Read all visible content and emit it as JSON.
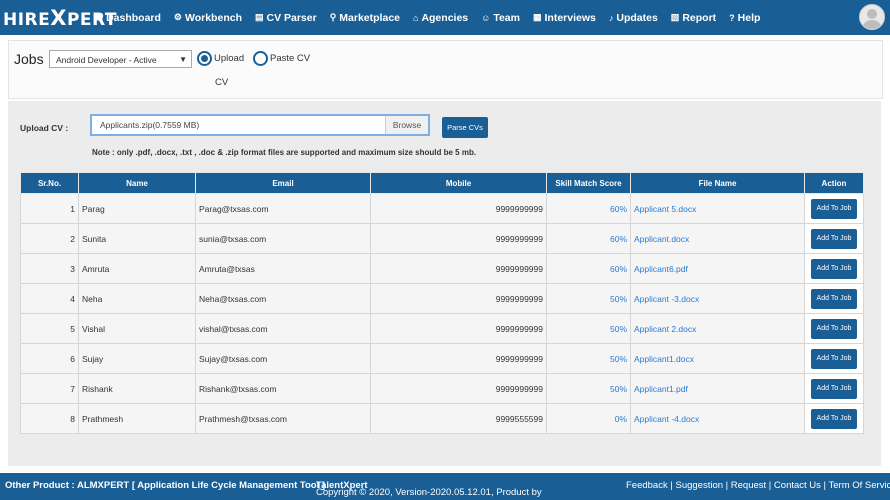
{
  "header": {
    "logo_left": "HIRE",
    "logo_x": "X",
    "logo_right": "PERT",
    "nav": [
      {
        "icon": "dashboard-icon",
        "glyph": "☗",
        "label": "Dashboard"
      },
      {
        "icon": "gears-icon",
        "glyph": "⚙",
        "label": "Workbench"
      },
      {
        "icon": "file-icon",
        "glyph": "▤",
        "label": "CV Parser"
      },
      {
        "icon": "map-marker-icon",
        "glyph": "⚲",
        "label": "Marketplace"
      },
      {
        "icon": "building-icon",
        "glyph": "⌂",
        "label": "Agencies"
      },
      {
        "icon": "users-icon",
        "glyph": "☺",
        "label": "Team"
      },
      {
        "icon": "calendar-icon",
        "glyph": "▦",
        "label": "Interviews"
      },
      {
        "icon": "bell-icon",
        "glyph": "♪",
        "label": "Updates"
      },
      {
        "icon": "report-icon",
        "glyph": "▧",
        "label": "Report"
      },
      {
        "icon": "question-icon",
        "glyph": "?",
        "label": "Help"
      }
    ]
  },
  "jobs": {
    "title": "Jobs",
    "selected_job": "Android Developer - Active",
    "option_upload": "Upload",
    "option_upload_line2": "CV",
    "option_paste": "Paste CV"
  },
  "upload": {
    "label": "Upload CV :",
    "file_value": "Applicants.zip(0.7559 MB)",
    "browse_label": "Browse",
    "parse_label": "Parse CVs",
    "note": "Note : only .pdf, .docx, .txt , .doc & .zip format files are supported and maximum size should be 5 mb."
  },
  "table": {
    "headers": [
      "Sr.No.",
      "Name",
      "Email",
      "Mobile",
      "Skill Match Score",
      "File Name",
      "Action"
    ],
    "action_label": "Add To Job",
    "rows": [
      {
        "sr": "1",
        "name": "Parag",
        "email": "Parag@txsas.com",
        "mobile": "9999999999",
        "score": "60%",
        "file": "Applicant 5.docx"
      },
      {
        "sr": "2",
        "name": "Sunita",
        "email": "sunia@txsas.com",
        "mobile": "9999999999",
        "score": "60%",
        "file": "Applicant.docx"
      },
      {
        "sr": "3",
        "name": "Amruta",
        "email": "Amruta@txsas",
        "mobile": "9999999999",
        "score": "60%",
        "file": "Applicant6.pdf"
      },
      {
        "sr": "4",
        "name": "Neha",
        "email": "Neha@txsas.com",
        "mobile": "9999999999",
        "score": "50%",
        "file": "Applicant -3.docx"
      },
      {
        "sr": "5",
        "name": "Vishal",
        "email": "vishal@txsas.com",
        "mobile": "9999999999",
        "score": "50%",
        "file": "Applicant 2.docx"
      },
      {
        "sr": "6",
        "name": "Sujay",
        "email": "Sujay@txsas.com",
        "mobile": "9999999999",
        "score": "50%",
        "file": "Applicant1.docx"
      },
      {
        "sr": "7",
        "name": "Rishank",
        "email": "Rishank@txsas.com",
        "mobile": "9999999999",
        "score": "50%",
        "file": "Applicant1.pdf"
      },
      {
        "sr": "8",
        "name": "Prathmesh",
        "email": "Prathmesh@txsas.com",
        "mobile": "9999555599",
        "score": "0%",
        "file": "Applicant -4.docx"
      }
    ]
  },
  "footer": {
    "other_product": "Other Product : ALMXPERT [ Application Life Cycle Management Tool ]",
    "copyright": "Copyright © 2020, Version-2020.05.12.01, Product by",
    "company": "TalentXpert",
    "links": [
      "Feedback",
      "Suggestion",
      "Request",
      "Contact Us",
      "Term Of Service"
    ]
  },
  "colors": {
    "brand": "#1a5e96",
    "link": "#2a7bd1"
  }
}
